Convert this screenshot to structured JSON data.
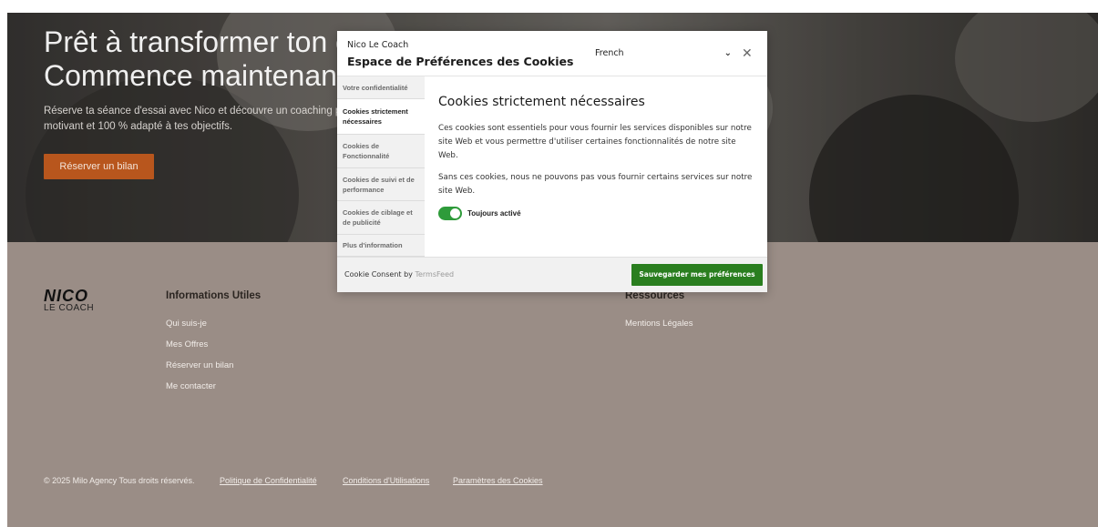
{
  "hero": {
    "title": "Prêt à transformer ton corps ? Commence maintenant.",
    "subtitle": "Réserve ta séance d'essai avec Nico et découvre un coaching personnalisé, motivant et 100 % adapté à tes objectifs.",
    "cta_label": "Réserver un bilan"
  },
  "footer": {
    "logo": {
      "line1": "NICO",
      "line2": "LE COACH"
    },
    "col1": {
      "title": "Informations Utiles",
      "links": [
        "Qui suis-je",
        "Mes Offres",
        "Réserver un bilan",
        "Me contacter"
      ]
    },
    "col2": {
      "title": "Ressources",
      "links": [
        "Mentions Légales"
      ]
    },
    "copyright": "© 2025 Milo Agency Tous droits réservés.",
    "bottom_links": [
      "Politique de Confidentialité",
      "Conditions d'Utilisations",
      "Paramètres des Cookies"
    ]
  },
  "dialog": {
    "brand": "Nico Le Coach",
    "title": "Espace de Préférences des Cookies",
    "language": "French",
    "close_glyph": "✕",
    "tabs": [
      "Votre confidentialité",
      "Cookies strictement nécessaires",
      "Cookies de Fonctionnalité",
      "Cookies de suivi et de performance",
      "Cookies de ciblage et de publicité",
      "Plus d'information"
    ],
    "active_tab": 1,
    "content": {
      "heading": "Cookies strictement nécessaires",
      "paragraph1": "Ces cookies sont essentiels pour vous fournir les services disponibles sur notre site Web et vous permettre d'utiliser certaines fonctionnalités de notre site Web.",
      "paragraph2": "Sans ces cookies, nous ne pouvons pas vous fournir certains services sur notre site Web.",
      "toggle_label": "Toujours activé",
      "toggle_on": true
    },
    "footer": {
      "consent_prefix": "Cookie Consent by ",
      "consent_link": "TermsFeed",
      "save_label": "Sauvegarder mes préférences"
    }
  },
  "colors": {
    "accent_orange": "#b8561d",
    "save_green": "#2a7e1f",
    "toggle_green": "#2e9b3a",
    "footer_bg": "#9a8d86"
  }
}
